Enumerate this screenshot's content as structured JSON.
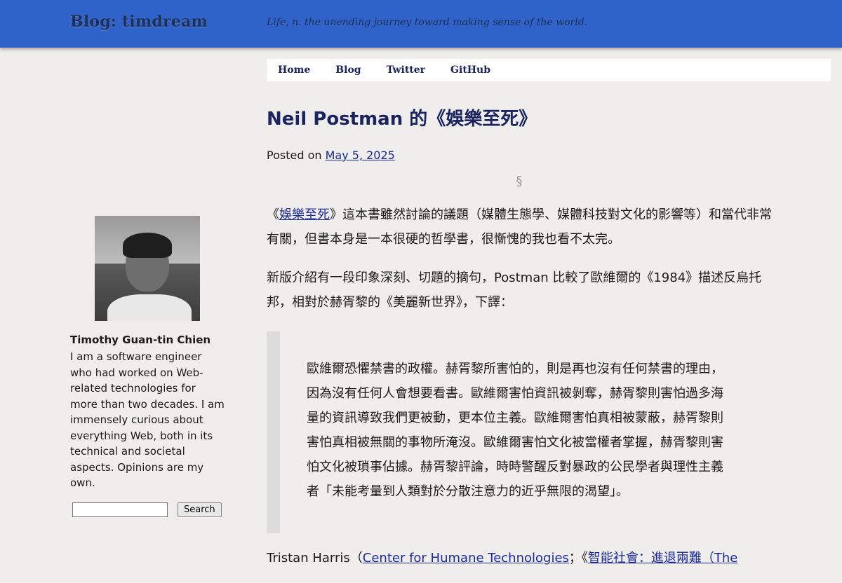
{
  "header": {
    "site_title": "Blog: timdream",
    "tagline": "Life, n. the unending journey toward making sense of the world."
  },
  "nav": {
    "items": [
      "Home",
      "Blog",
      "Twitter",
      "GitHub"
    ]
  },
  "sidebar": {
    "author_name": "Timothy Guan-tin Chien",
    "bio": "I am a software engineer who had worked on Web-related technologies for more than two decades. I am immensely curious about everything Web, both in its technical and societal aspects. Opinions are my own.",
    "search_placeholder": "",
    "search_button": "Search"
  },
  "post": {
    "title": "Neil Postman 的《娛樂至死》",
    "posted_on_label": "Posted on",
    "date": "May 5, 2025",
    "section_mark": "§",
    "p1_open": "《",
    "p1_link": "娛樂至死",
    "p1_rest": "》這本書雖然討論的議題（媒體生態學、媒體科技對文化的影響等）和當代非常有關，但書本身是一本很硬的哲學書，很慚愧的我也看不太完。",
    "p2": "新版介紹有一段印象深刻、切題的摘句，Postman 比較了歐維爾的《1984》描述反烏托邦，相對於赫胥黎的《美麗新世界》，下譯：",
    "quote": "歐維爾恐懼禁書的政權。赫胥黎所害怕的，則是再也沒有任何禁書的理由，因為沒有任何人會想要看書。歐維爾害怕資訊被剝奪，赫胥黎則害怕過多海量的資訊導致我們更被動，更本位主義。歐維爾害怕真相被蒙蔽，赫胥黎則害怕真相被無關的事物所淹沒。歐維爾害怕文化被當權者掌握，赫胥黎則害怕文化被瑣事佔據。赫胥黎評論，時時警醒反對暴政的公民學者與理性主義者「未能考量到人類對於分散注意力的近乎無限的渴望」。",
    "p3_start": "Tristan Harris（",
    "p3_link1": "Center for Humane Technologies",
    "p3_mid": "；《",
    "p3_link2": "智能社會：進退兩難（The"
  },
  "colors": {
    "header_bg": "#2f63c9",
    "title_text": "#1b2460",
    "link": "#1b2a9e",
    "page_bg": "#efeeec"
  }
}
